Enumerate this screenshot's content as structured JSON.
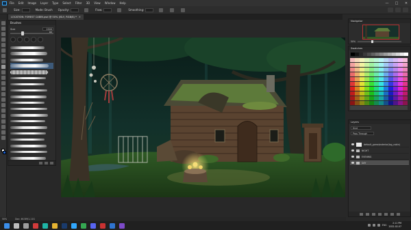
{
  "menubar": {
    "items": [
      "File",
      "Edit",
      "Image",
      "Layer",
      "Type",
      "Select",
      "Filter",
      "3D",
      "View",
      "Window",
      "Help"
    ],
    "window_controls": [
      "—",
      "□",
      "✕"
    ]
  },
  "options": {
    "size_label": "Size:",
    "mode_label": "Mode:",
    "mode_value": "Brush",
    "opacity_label": "Opacity:",
    "flow_label": "Flow:",
    "smoothing_label": "Smoothing:"
  },
  "document": {
    "tab_title": "LOCATION: FOREST CABIN.psd @ 50% (ISLY, RGB/8) *",
    "tab_close": "✕"
  },
  "brushes_panel": {
    "title": "Brushes",
    "size_label": "Size",
    "size_value": "1500 px"
  },
  "navigator": {
    "title": "Navigator",
    "zoom": "50%"
  },
  "swatches": {
    "title": "Swatches"
  },
  "layers": {
    "title": "Layers",
    "kind_filter": "Kind",
    "blend_mode": "Pass Through",
    "rows": [
      {
        "name": "default_game/exterior(log_cabin)",
        "type": "layer",
        "selected": false
      },
      {
        "name": "NIGHT",
        "type": "folder",
        "selected": false
      },
      {
        "name": "EVENING",
        "type": "folder",
        "selected": false
      },
      {
        "name": "DAY",
        "type": "folder",
        "selected": true
      }
    ]
  },
  "status": {
    "zoom": "50%",
    "doc_info": "Doc: 46.5M/1.11G"
  },
  "taskbar": {
    "time": "2:11 PM",
    "date": "2022-02-07",
    "lang": "ENG",
    "icons": [
      {
        "name": "windows-start",
        "color": "#3b8eea"
      },
      {
        "name": "search",
        "color": "#bdbdbd"
      },
      {
        "name": "task-view",
        "color": "#9e9e9e"
      },
      {
        "name": "app-red",
        "color": "#d23b3b"
      },
      {
        "name": "app-teal",
        "color": "#1fb5a6"
      },
      {
        "name": "app-chrome",
        "color": "#e6b432"
      },
      {
        "name": "app-steam",
        "color": "#1a3b6c"
      },
      {
        "name": "app-photoshop",
        "color": "#31a8ff"
      },
      {
        "name": "app-green",
        "color": "#35a852"
      },
      {
        "name": "app-discord",
        "color": "#5865f2"
      },
      {
        "name": "app-red-2",
        "color": "#c93232"
      },
      {
        "name": "app-blue",
        "color": "#2f74d0"
      },
      {
        "name": "app-purple",
        "color": "#7d4bc9"
      }
    ]
  },
  "colors": {
    "foreground": "#ffffff",
    "background": "#1b5cc5",
    "accent": "#31a8ff"
  }
}
